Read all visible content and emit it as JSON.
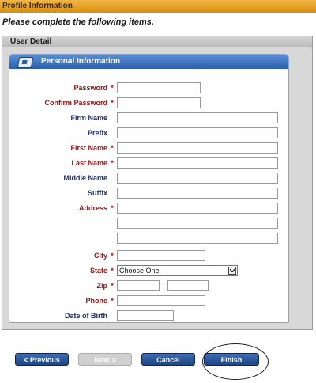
{
  "window": {
    "title": "Profile Information"
  },
  "instruction": "Please complete the following items.",
  "section": {
    "title": "User Detail"
  },
  "panel": {
    "title": "Personal Information",
    "icon": "id-card-icon"
  },
  "required_marker": "*",
  "fields": {
    "password": {
      "label": "Password",
      "value": "",
      "required": true
    },
    "confirm_password": {
      "label": "Confirm Password",
      "value": "",
      "required": true
    },
    "firm_name": {
      "label": "Firm Name",
      "value": "",
      "required": false
    },
    "prefix": {
      "label": "Prefix",
      "value": "",
      "required": false
    },
    "first_name": {
      "label": "First Name",
      "value": "",
      "required": true
    },
    "last_name": {
      "label": "Last Name",
      "value": "",
      "required": true
    },
    "middle_name": {
      "label": "Middle Name",
      "value": "",
      "required": false
    },
    "suffix": {
      "label": "Suffix",
      "value": "",
      "required": false
    },
    "address": {
      "label": "Address",
      "lines": [
        "",
        "",
        ""
      ],
      "required": true
    },
    "city": {
      "label": "City",
      "value": "",
      "required": true
    },
    "state": {
      "label": "State",
      "selected": "Choose One",
      "required": true
    },
    "zip": {
      "label": "Zip",
      "value": "",
      "ext": "",
      "required": true
    },
    "phone": {
      "label": "Phone",
      "value": "",
      "required": true
    },
    "dob": {
      "label": "Date of Birth",
      "value": "",
      "required": false
    }
  },
  "buttons": {
    "previous": "< Previous",
    "next": "Next >",
    "cancel": "Cancel",
    "finish": "Finish"
  },
  "colors": {
    "title_bar": "#e8a22a",
    "panel_header": "#3b6fbf",
    "required_label": "#8d1515",
    "optional_label": "#1b2a66",
    "button": "#2a559a"
  }
}
